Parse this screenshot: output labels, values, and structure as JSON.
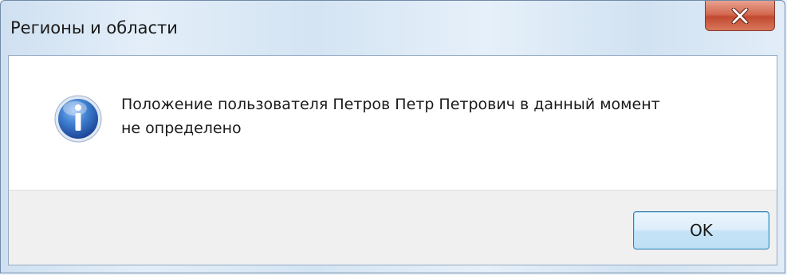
{
  "window": {
    "title": "Регионы и области"
  },
  "titlebar": {
    "close_icon": "close-icon"
  },
  "dialog": {
    "icon": "info-icon",
    "message": "Положение пользователя Петров Петр Петрович в данный момент\nне определено"
  },
  "buttons": {
    "ok_label": "OK"
  },
  "colors": {
    "close_button": "#c94a30",
    "info_icon": "#2c6ac2",
    "ok_border": "#3c7fb1",
    "button_area": "#f0f0f0"
  }
}
